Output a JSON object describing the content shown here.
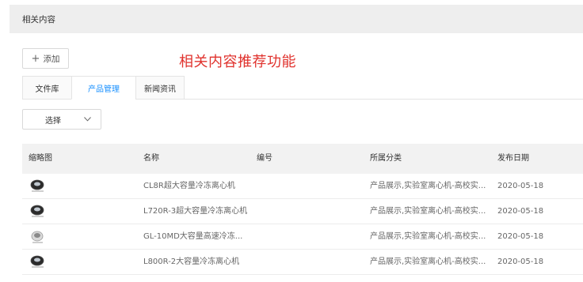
{
  "header": {
    "title": "相关内容"
  },
  "toolbar": {
    "add_label": "添加",
    "add_icon": "plus-icon"
  },
  "annotation": {
    "text": "相关内容推荐功能",
    "color": "#e0322d"
  },
  "tabs": [
    {
      "label": "文件库",
      "active": false
    },
    {
      "label": "产品管理",
      "active": true
    },
    {
      "label": "新闻资讯",
      "active": false
    }
  ],
  "filter": {
    "selected": "选择",
    "icon": "chevron-down-icon"
  },
  "table": {
    "columns": [
      "缩略图",
      "名称",
      "编号",
      "所属分类",
      "发布日期"
    ],
    "rows": [
      {
        "thumb": "centrifuge-thumbnail",
        "name": "CL8R超大容量冷冻离心机",
        "code": "",
        "category": "产品展示,实验室离心机-高校实...",
        "date": "2020-05-18"
      },
      {
        "thumb": "centrifuge-thumbnail",
        "name": "L720R-3超大容量冷冻离心机",
        "code": "",
        "category": "产品展示,实验室离心机-高校实...",
        "date": "2020-05-18"
      },
      {
        "thumb": "centrifuge-thumbnail",
        "name": "GL-10MD大容量高速冷冻...",
        "code": "",
        "category": "产品展示,实验室离心机-高校实...",
        "date": "2020-05-18"
      },
      {
        "thumb": "centrifuge-thumbnail",
        "name": "L800R-2大容量冷冻离心机",
        "code": "",
        "category": "产品展示,实验室离心机-高校实...",
        "date": "2020-05-18"
      }
    ]
  },
  "colors": {
    "accent": "#1890ff",
    "header_bg": "#eeeeee",
    "table_header_bg": "#f2f2f2"
  }
}
